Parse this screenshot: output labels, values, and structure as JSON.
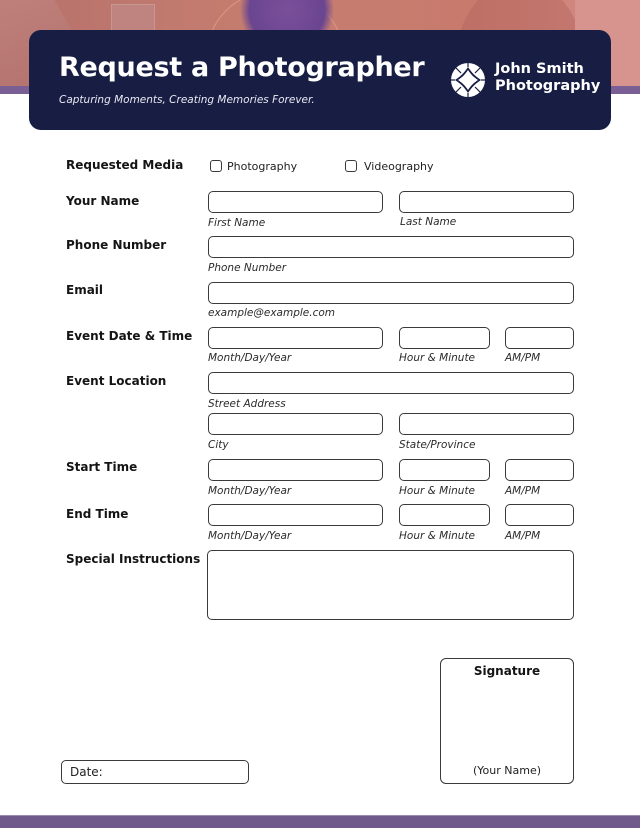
{
  "header": {
    "title": "Request a Photographer",
    "subtitle": "Capturing Moments, Creating Memories Forever.",
    "brand_line1": "John Smith",
    "brand_line2": "Photography",
    "logo_icon": "globe-lens-icon",
    "card_color": "#171d43",
    "accent_color": "#6f5a8b"
  },
  "form": {
    "requested_media": {
      "label": "Requested Media",
      "options": [
        {
          "label": "Photography",
          "checked": false
        },
        {
          "label": "Videography",
          "checked": false
        }
      ]
    },
    "your_name": {
      "label": "Your Name",
      "first_hint": "First Name",
      "last_hint": "Last Name",
      "first_value": "",
      "last_value": ""
    },
    "phone": {
      "label": "Phone Number",
      "hint": "Phone Number",
      "value": ""
    },
    "email": {
      "label": "Email",
      "hint": "example@example.com",
      "value": ""
    },
    "event_date_time": {
      "label": "Event Date & Time",
      "date_hint": "Month/Day/Year",
      "time_hint": "Hour & Minute",
      "ampm_hint": "AM/PM"
    },
    "event_location": {
      "label": "Event Location",
      "street_hint": "Street Address",
      "city_hint": "City",
      "state_hint": "State/Province"
    },
    "start_time": {
      "label": "Start Time",
      "date_hint": "Month/Day/Year",
      "time_hint": "Hour & Minute",
      "ampm_hint": "AM/PM"
    },
    "end_time": {
      "label": "End Time",
      "date_hint": "Month/Day/Year",
      "time_hint": "Hour & Minute",
      "ampm_hint": "AM/PM"
    },
    "special_instructions": {
      "label": "Special Instructions",
      "value": ""
    }
  },
  "signature": {
    "title": "Signature",
    "name_placeholder": "(Your Name)"
  },
  "date_field": {
    "label": "Date:"
  }
}
